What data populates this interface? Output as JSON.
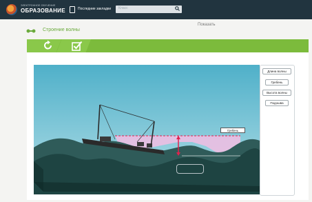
{
  "header": {
    "brand_small": "ЭЛЕКТРОННОЕ ОБУЧЕНИЕ",
    "brand": "ОБРАЗОВАНИЕ",
    "last_bookmarks": "Последние закладки",
    "search_placeholder": "Класс"
  },
  "show_label": "Показать",
  "page_title": "Строение волны",
  "answer_options": [
    "Длина волны",
    "Гребень",
    "Высота волны",
    "Подошва"
  ],
  "placed_label": "Гребень",
  "colors": {
    "topbar": "#21343f",
    "accent_green": "#7cbb3c",
    "title_green": "#6aaa3c",
    "sky": "#8ed1df",
    "water": "#224c4a",
    "highlight": "#f2bde3",
    "marker": "#e0224e"
  },
  "icons": {
    "logo": "globe-logo-icon",
    "bookmark": "bookmark-icon",
    "search": "search-icon",
    "back": "back-arrow-icon",
    "reload": "reload-icon",
    "check": "check-icon"
  }
}
